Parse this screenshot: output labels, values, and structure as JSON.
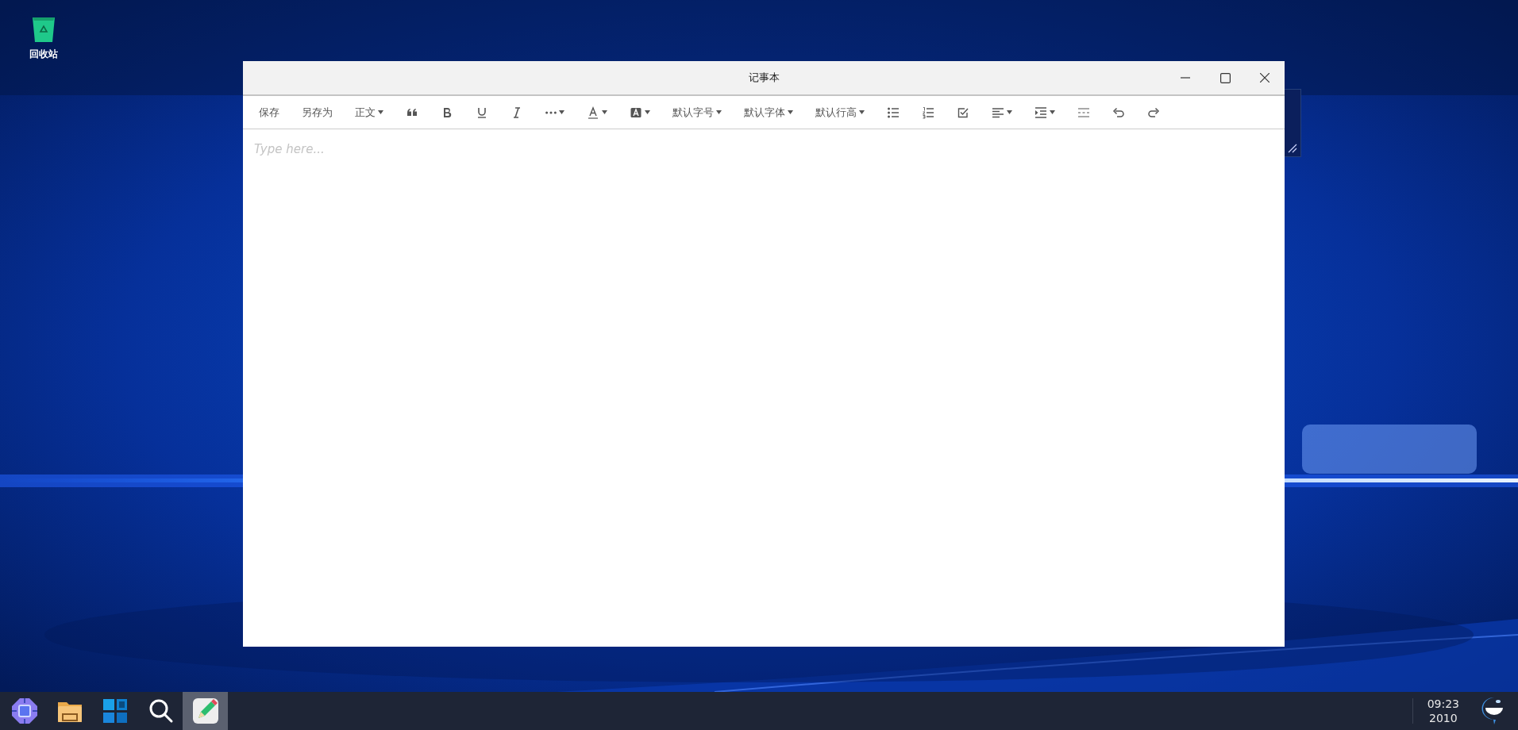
{
  "desktop": {
    "icons": [
      {
        "label": "回收站",
        "kind": "recycle-bin"
      }
    ]
  },
  "window": {
    "title": "记事本",
    "toolbar": [
      {
        "kind": "text",
        "label": "保存",
        "dropdown": false
      },
      {
        "kind": "text",
        "label": "另存为",
        "dropdown": false
      },
      {
        "kind": "text",
        "label": "正文",
        "dropdown": true
      },
      {
        "kind": "quote",
        "dropdown": false
      },
      {
        "kind": "bold",
        "dropdown": false
      },
      {
        "kind": "underline",
        "dropdown": false
      },
      {
        "kind": "italic",
        "dropdown": false
      },
      {
        "kind": "more",
        "dropdown": true
      },
      {
        "kind": "font-color",
        "dropdown": true
      },
      {
        "kind": "highlight",
        "dropdown": true
      },
      {
        "kind": "text",
        "label": "默认字号",
        "dropdown": true
      },
      {
        "kind": "text",
        "label": "默认字体",
        "dropdown": true
      },
      {
        "kind": "text",
        "label": "默认行高",
        "dropdown": true
      },
      {
        "kind": "bullet-list",
        "dropdown": false
      },
      {
        "kind": "ordered-list",
        "dropdown": false
      },
      {
        "kind": "task-list",
        "dropdown": false
      },
      {
        "kind": "align",
        "dropdown": true
      },
      {
        "kind": "indent",
        "dropdown": true
      },
      {
        "kind": "divider",
        "dropdown": false
      },
      {
        "kind": "undo",
        "dropdown": false
      },
      {
        "kind": "redo",
        "dropdown": false
      }
    ],
    "editor": {
      "placeholder": "Type here..."
    }
  },
  "taskbar": {
    "items": [
      {
        "kind": "launcher",
        "selected": false
      },
      {
        "kind": "folder",
        "selected": false
      },
      {
        "kind": "tiles",
        "selected": false
      },
      {
        "kind": "search",
        "selected": false
      },
      {
        "kind": "notepad",
        "selected": true
      }
    ],
    "clock": {
      "time": "09:23",
      "year": "2010"
    }
  }
}
